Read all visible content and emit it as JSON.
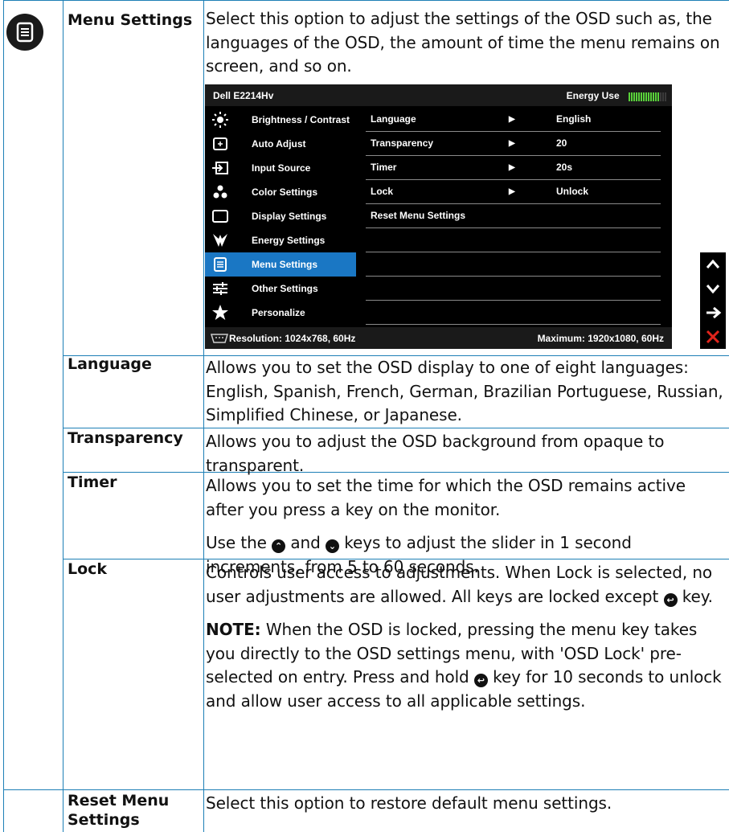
{
  "rows": {
    "menu": {
      "title": "Menu Settings",
      "desc": "Select this option to adjust the settings of the OSD such as, the languages of the OSD, the amount of time the menu remains on screen, and so on."
    },
    "language": {
      "title": "Language",
      "desc": "Allows you to set the OSD display to one of eight languages: English, Spanish, French, German, Brazilian Portuguese, Russian, Simplified Chinese, or Japanese."
    },
    "transparency": {
      "title": "Transparency",
      "desc": "Allows you to adjust the OSD background from opaque to transparent."
    },
    "timer": {
      "title": "Timer",
      "desc1": "Allows you to set the time for which the OSD remains active after you press a key on the monitor.",
      "desc2_a": "Use the",
      "desc2_b": "and",
      "desc2_c": "keys to adjust the slider in 1 second increments, from 5 to 60 seconds."
    },
    "lock": {
      "title": "Lock",
      "desc1_a": "Controls user access to adjustments. When Lock is selected, no user adjustments are allowed. All keys are locked except",
      "desc1_b": "key.",
      "note_label": "NOTE:",
      "note_a": "When the OSD is locked, pressing the menu key takes you directly to the OSD settings menu, with 'OSD Lock' pre-selected on entry. Press and hold",
      "note_b": "key for 10 seconds to unlock and allow user access to all applicable settings."
    },
    "reset": {
      "title": "Reset Menu Settings",
      "desc": "Select this option to restore default menu settings."
    }
  },
  "osd": {
    "model": "Dell E2214Hv",
    "energy_label": "Energy Use",
    "energy_level": 0.8,
    "sidebar": [
      {
        "label": "Brightness / Contrast",
        "icon": "brightness-icon"
      },
      {
        "label": "Auto Adjust",
        "icon": "auto-adjust-icon"
      },
      {
        "label": "Input Source",
        "icon": "input-source-icon"
      },
      {
        "label": "Color Settings",
        "icon": "color-settings-icon"
      },
      {
        "label": "Display Settings",
        "icon": "display-settings-icon"
      },
      {
        "label": "Energy Settings",
        "icon": "energy-settings-icon"
      },
      {
        "label": "Menu Settings",
        "icon": "menu-settings-icon",
        "active": true
      },
      {
        "label": "Other Settings",
        "icon": "other-settings-icon"
      },
      {
        "label": "Personalize",
        "icon": "star-icon"
      }
    ],
    "options": [
      {
        "name": "Language",
        "value": "English"
      },
      {
        "name": "Transparency",
        "value": "20"
      },
      {
        "name": "Timer",
        "value": "20s"
      },
      {
        "name": "Lock",
        "value": "Unlock"
      },
      {
        "name": "Reset Menu Settings",
        "value": ""
      }
    ],
    "resolution": "Resolution: 1024x768,  60Hz",
    "maximum": "Maximum: 1920x1080,  60Hz"
  },
  "colors": {
    "accent": "#1a77c4",
    "grid": "#1d7fb6",
    "energy": "#59d23a",
    "close": "#e0241c"
  }
}
